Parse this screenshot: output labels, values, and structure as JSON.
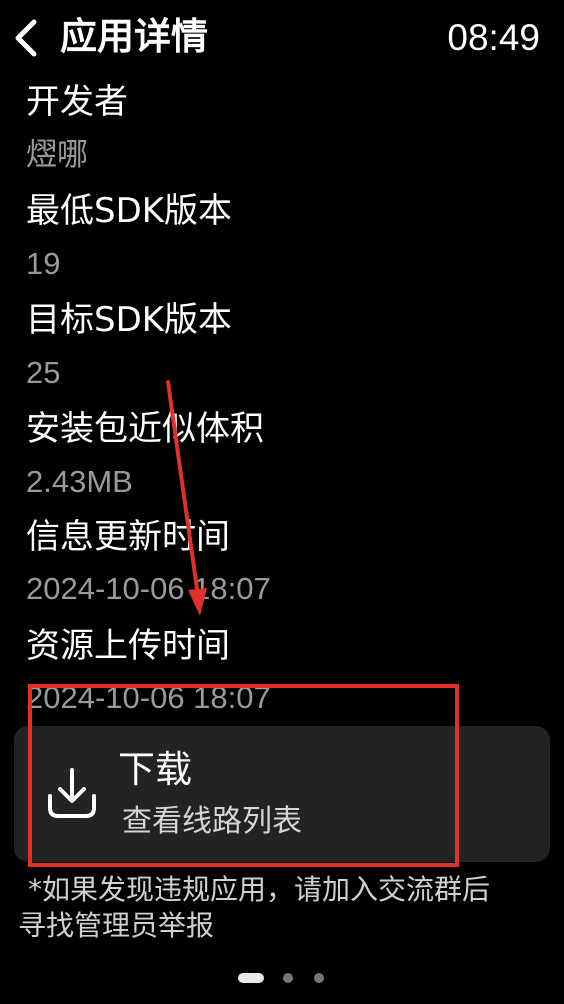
{
  "header": {
    "back_icon": "chevron-left-icon",
    "title": "应用详情",
    "time": "08:49"
  },
  "details": [
    {
      "label": "开发者",
      "value": "熤哪"
    },
    {
      "label": "最低SDK版本",
      "value": "19"
    },
    {
      "label": "目标SDK版本",
      "value": "25"
    },
    {
      "label": "安装包近似体积",
      "value": "2.43MB"
    },
    {
      "label": "信息更新时间",
      "value": "2024-10-06 18:07"
    },
    {
      "label": "资源上传时间",
      "value": "2024-10-06 18:07"
    }
  ],
  "download": {
    "icon": "download-icon",
    "title": "下载",
    "subtitle": "查看线路列表"
  },
  "notice": {
    "line1": "*如果发现违规应用，请加入交流群后",
    "line2": "寻找管理员举报"
  },
  "pager": {
    "total_pages": 3,
    "current_page": 1
  },
  "colors": {
    "background": "#000000",
    "card": "#232323",
    "value_text": "#9a9a9a",
    "annotation": "#e0302a"
  }
}
